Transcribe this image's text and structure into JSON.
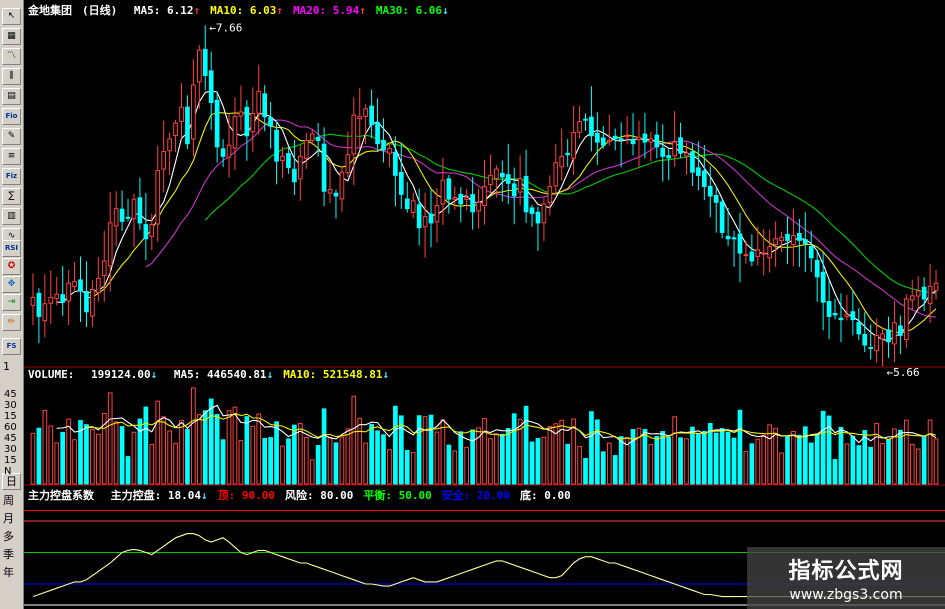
{
  "chart_data": {
    "type": "candlestick",
    "stock_name": "金地集团",
    "period": "(日线)",
    "ma_labels": [
      {
        "name": "MA5:",
        "value": "6.12",
        "arrow": "↑",
        "color": "#ffffff"
      },
      {
        "name": "MA10:",
        "value": "6.03",
        "arrow": "↑",
        "color": "#ffff00"
      },
      {
        "name": "MA20:",
        "value": "5.94",
        "arrow": "↑",
        "color": "#ff00ff"
      },
      {
        "name": "MA30:",
        "value": "6.06",
        "arrow": "↓",
        "color": "#00ff00"
      }
    ],
    "high_label": "7.66",
    "low_label": "5.66",
    "price_range": [
      5.55,
      7.72
    ],
    "price_ticks": [],
    "closes": [
      5.97,
      5.85,
      5.93,
      5.97,
      5.99,
      5.94,
      6.06,
      6.07,
      6.01,
      5.88,
      6.02,
      6.09,
      6.2,
      6.44,
      6.53,
      6.45,
      6.47,
      6.59,
      6.44,
      6.34,
      6.43,
      6.77,
      6.89,
      6.97,
      7.07,
      7.17,
      6.94,
      7.31,
      7.53,
      7.37,
      7.2,
      6.92,
      6.86,
      6.93,
      7.11,
      7.14,
      6.99,
      7.13,
      7.27,
      7.11,
      7.05,
      6.83,
      6.86,
      6.79,
      6.7,
      6.86,
      6.96,
      7.0,
      6.96,
      6.64,
      6.65,
      6.61,
      6.76,
      6.87,
      7.12,
      7.11,
      7.16,
      7.06,
      6.94,
      6.9,
      6.91,
      6.74,
      6.62,
      6.53,
      6.58,
      6.41,
      6.48,
      6.44,
      6.55,
      6.71,
      6.59,
      6.6,
      6.56,
      6.6,
      6.51,
      6.57,
      6.67,
      6.74,
      6.78,
      6.73,
      6.69,
      6.61,
      6.72,
      6.51,
      6.5,
      6.44,
      6.56,
      6.67,
      6.82,
      6.86,
      6.87,
      7.01,
      7.08,
      7.09,
      6.99,
      6.95,
      6.93,
      6.96,
      6.97,
      6.97,
      6.99,
      6.94,
      6.98,
      6.95,
      6.97,
      6.92,
      6.86,
      6.85,
      6.95,
      6.88,
      6.88,
      6.76,
      6.74,
      6.67,
      6.61,
      6.57,
      6.38,
      6.34,
      6.34,
      6.25,
      6.24,
      6.2,
      6.27,
      6.25,
      6.29,
      6.34,
      6.35,
      6.33,
      6.36,
      6.33,
      6.31,
      6.22,
      6.1,
      5.94,
      5.85,
      5.86,
      5.83,
      5.86,
      5.83,
      5.74,
      5.67,
      5.65,
      5.73,
      5.74,
      5.69,
      5.81,
      5.73,
      5.96,
      5.98,
      6.01,
      5.96,
      6.04,
      6.06
    ],
    "volume_label": "VOLUME:",
    "volume_value": "199124.00",
    "volume_arrow": "↓",
    "volume_ma": [
      {
        "name": "MA5:",
        "value": "446540.81",
        "arrow": "↓",
        "color": "#ffffff"
      },
      {
        "name": "MA10:",
        "value": "521548.81",
        "arrow": "↓",
        "color": "#ffff00"
      }
    ],
    "volume_ticks": [
      "45",
      "30",
      "15",
      "N"
    ],
    "volume_ticks_left": [
      "1",
      "45",
      "30",
      "15",
      "60",
      "45",
      "30",
      "15",
      "N"
    ],
    "indicator": {
      "name": "主力控盘系数",
      "fields": [
        {
          "label": "主力控盘:",
          "value": "18.04",
          "arrow": "↓",
          "color": "#ffffff"
        },
        {
          "label": "顶:",
          "value": "90.00",
          "color": "#ff0000"
        },
        {
          "label": "风险:",
          "value": "80.00",
          "color": "#ffffff"
        },
        {
          "label": "平衡:",
          "value": "50.00",
          "color": "#00ff00"
        },
        {
          "label": "安全:",
          "value": "20.00",
          "color": "#0000ff"
        },
        {
          "label": "底:",
          "value": "0.00",
          "color": "#ffffff"
        }
      ],
      "levels": [
        90,
        80,
        50,
        20,
        0
      ],
      "values": [
        8,
        10,
        12,
        14,
        16,
        18,
        20,
        22,
        22,
        24,
        28,
        32,
        36,
        40,
        45,
        50,
        52,
        53,
        52,
        50,
        48,
        52,
        56,
        60,
        64,
        66,
        68,
        68,
        66,
        62,
        60,
        62,
        64,
        60,
        55,
        50,
        48,
        50,
        52,
        52,
        50,
        48,
        46,
        44,
        42,
        40,
        40,
        38,
        36,
        34,
        32,
        30,
        28,
        26,
        24,
        22,
        20,
        20,
        19,
        18,
        18,
        20,
        22,
        24,
        26,
        24,
        22,
        22,
        22,
        24,
        26,
        28,
        30,
        32,
        34,
        36,
        38,
        40,
        42,
        42,
        40,
        38,
        36,
        34,
        32,
        30,
        28,
        26,
        26,
        28,
        34,
        40,
        44,
        46,
        46,
        44,
        42,
        40,
        40,
        38,
        36,
        34,
        32,
        30,
        28,
        26,
        24,
        22,
        20,
        18,
        16,
        14,
        12,
        10,
        10,
        9,
        8,
        8,
        8,
        8,
        8,
        8,
        8,
        8,
        8,
        8,
        8,
        8,
        8,
        8,
        8,
        8,
        8,
        8,
        8,
        8,
        8,
        8,
        8,
        8,
        8,
        8,
        8,
        8,
        8,
        8,
        8,
        8,
        8,
        8,
        8,
        8,
        8,
        8,
        8,
        8
      ]
    }
  },
  "toolbar": {
    "labels": [
      "RSI",
      "FS",
      "1",
      "日",
      "周",
      "月",
      "多",
      "季",
      "年"
    ],
    "text_buttons": [
      "Fio",
      "Fiz"
    ]
  },
  "watermark": {
    "title": "指标公式网",
    "url": "www.zbgs3.com"
  }
}
